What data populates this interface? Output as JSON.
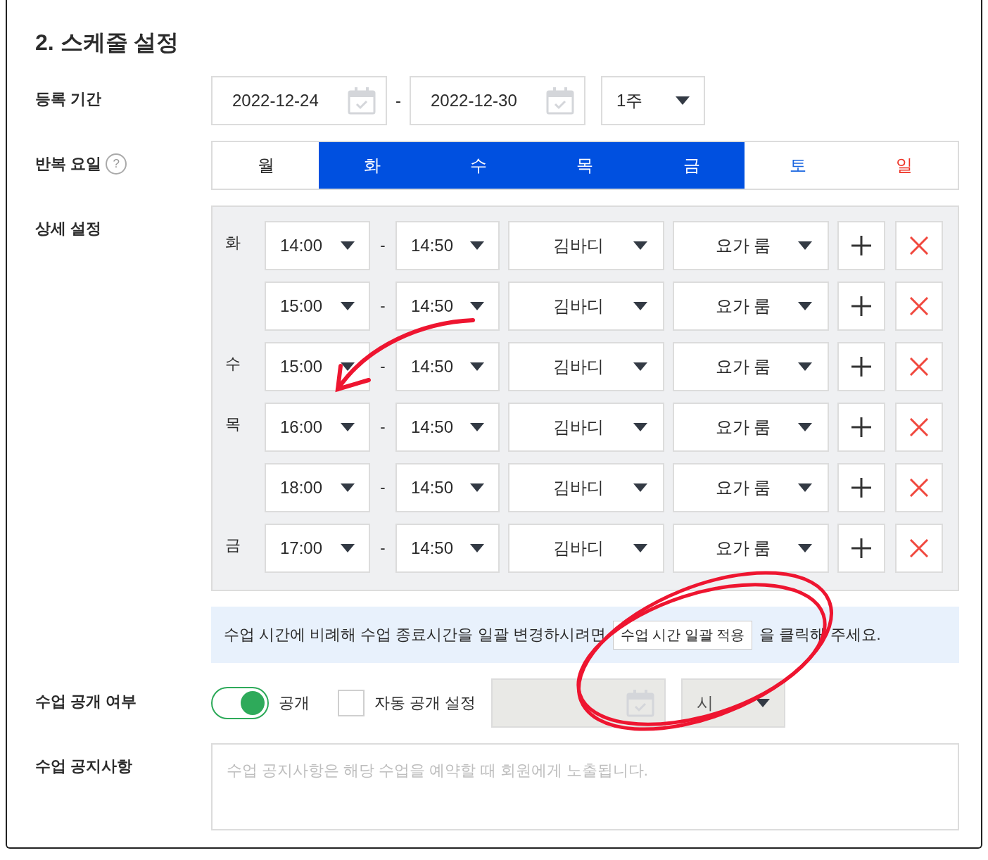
{
  "heading": "2. 스케줄 설정",
  "period": {
    "label": "등록 기간",
    "start": "2022-12-24",
    "separator": "-",
    "end": "2022-12-30",
    "duration": "1주"
  },
  "repeat": {
    "label": "반복 요일",
    "help": "?",
    "days": [
      {
        "label": "월",
        "selected": false,
        "kind": "weekday"
      },
      {
        "label": "화",
        "selected": true,
        "kind": "weekday"
      },
      {
        "label": "수",
        "selected": true,
        "kind": "weekday"
      },
      {
        "label": "목",
        "selected": true,
        "kind": "weekday"
      },
      {
        "label": "금",
        "selected": true,
        "kind": "weekday"
      },
      {
        "label": "토",
        "selected": false,
        "kind": "saturday"
      },
      {
        "label": "일",
        "selected": false,
        "kind": "sunday"
      }
    ]
  },
  "detail": {
    "label": "상세 설정",
    "rows": [
      {
        "day": "화",
        "start": "14:00",
        "separator": "-",
        "end": "14:50",
        "instructor": "김바디",
        "room": "요가 룸"
      },
      {
        "start": "15:00",
        "separator": "-",
        "end": "14:50",
        "instructor": "김바디",
        "room": "요가 룸"
      },
      {
        "day": "수",
        "start": "15:00",
        "separator": "-",
        "end": "14:50",
        "instructor": "김바디",
        "room": "요가 룸"
      },
      {
        "day": "목",
        "start": "16:00",
        "separator": "-",
        "end": "14:50",
        "instructor": "김바디",
        "room": "요가 룸"
      },
      {
        "start": "18:00",
        "separator": "-",
        "end": "14:50",
        "instructor": "김바디",
        "room": "요가 룸"
      },
      {
        "day": "금",
        "start": "17:00",
        "separator": "-",
        "end": "14:50",
        "instructor": "김바디",
        "room": "요가 룸"
      }
    ]
  },
  "info_bar": {
    "before": "수업 시간에 비례해 수업 종료시간을 일괄 변경하시려면",
    "button": "수업 시간 일괄 적용",
    "after": "을 클릭해 주세요."
  },
  "visibility": {
    "label": "수업 공개 여부",
    "toggle_on": true,
    "toggle_label": "공개",
    "auto": {
      "label": "자동 공개 설정",
      "checked": false
    },
    "date_disabled": true,
    "hour": "시",
    "hour_disabled": true
  },
  "notice": {
    "label": "수업 공지사항",
    "placeholder": "수업 공지사항은 해당 수업을 예약할 때 회원에게 노출됩니다."
  },
  "annotations": {
    "arrow": true,
    "circle": true
  }
}
